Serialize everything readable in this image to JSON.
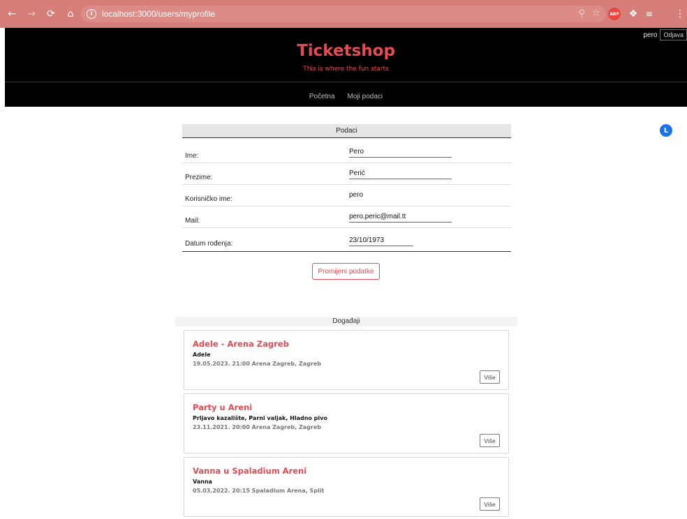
{
  "browser": {
    "url": "localhost:3000/users/myprofile",
    "abp_label": "ABP",
    "profile_initial": "L"
  },
  "site": {
    "title": "Ticketshop",
    "subtitle": "This is where the fun starts",
    "username": "pero",
    "logout_label": "Odjava",
    "nav": [
      "Početna",
      "Moji podaci"
    ]
  },
  "profile": {
    "header": "Podaci",
    "rows": [
      {
        "label": "Ime:",
        "value": "Pero"
      },
      {
        "label": "Prezime:",
        "value": "Perić"
      },
      {
        "label": "Korisničko ime:",
        "value": "pero"
      },
      {
        "label": "Mail:",
        "value": "pero.peric@mail.tt"
      },
      {
        "label": "Datum rođenja:",
        "value": "23/10/1973"
      }
    ],
    "update_button": "Promijeni podatke"
  },
  "events": {
    "header": "Događaji",
    "more_label": "Više",
    "items": [
      {
        "title": "Adele - Arena Zagreb",
        "performers": "Adele",
        "meta": "19.05.2023. 21:00 Arena Zagreb, Zagreb"
      },
      {
        "title": "Party u Areni",
        "performers": "Prljavo kazalište, Parni valjak, Hladno pivo",
        "meta": "23.11.2021. 20:00 Arena Zagreb, Zagreb"
      },
      {
        "title": "Vanna u Spaladium Areni",
        "performers": "Vanna",
        "meta": "05.03.2022. 20:15 Spaladium Arena, Split"
      }
    ]
  },
  "colors": {
    "chrome": "#d67f7a",
    "accent": "#e74a52",
    "header_bg": "#000000"
  }
}
